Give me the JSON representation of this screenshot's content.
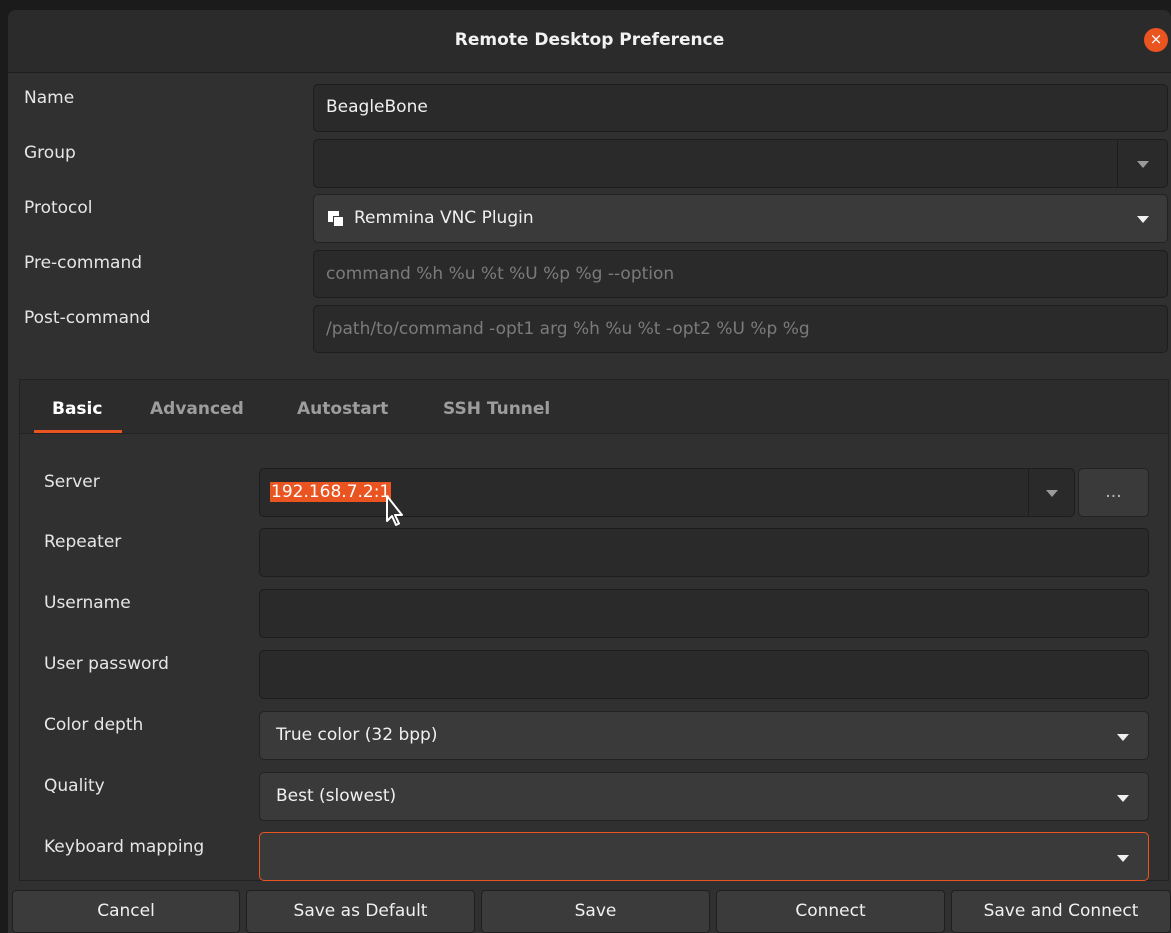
{
  "window": {
    "title": "Remote Desktop Preference",
    "close_icon": "×"
  },
  "profile": {
    "name_label": "Name",
    "name_value": "BeagleBone",
    "group_label": "Group",
    "group_value": "",
    "protocol_label": "Protocol",
    "protocol_value": "Remmina VNC Plugin",
    "precommand_label": "Pre-command",
    "precommand_placeholder": "command %h %u %t %U %p %g --option",
    "postcommand_label": "Post-command",
    "postcommand_placeholder": "/path/to/command -opt1 arg %h %u %t -opt2 %U %p %g"
  },
  "tabs": [
    {
      "label": "Basic",
      "active": true
    },
    {
      "label": "Advanced",
      "active": false
    },
    {
      "label": "Autostart",
      "active": false
    },
    {
      "label": "SSH Tunnel",
      "active": false
    }
  ],
  "basic": {
    "server_label": "Server",
    "server_value": "192.168.7.2:1",
    "server_browse": "...",
    "repeater_label": "Repeater",
    "repeater_value": "",
    "username_label": "Username",
    "username_value": "",
    "password_label": "User password",
    "password_value": "",
    "colordepth_label": "Color depth",
    "colordepth_value": "True color (32 bpp)",
    "quality_label": "Quality",
    "quality_value": "Best (slowest)",
    "keymap_label": "Keyboard mapping",
    "keymap_value": ""
  },
  "buttons": {
    "cancel": "Cancel",
    "save_default": "Save as Default",
    "save": "Save",
    "connect": "Connect",
    "save_connect": "Save and Connect"
  },
  "colors": {
    "accent": "#e95420",
    "window_bg": "#303030",
    "field_bg": "#2a2a2a",
    "combo_bg": "#3a3a3a"
  },
  "icons": {
    "protocol": "vnc-plugin-icon",
    "close": "close-icon",
    "dropdown": "chevron-down-icon",
    "cursor": "mouse-pointer-icon"
  }
}
